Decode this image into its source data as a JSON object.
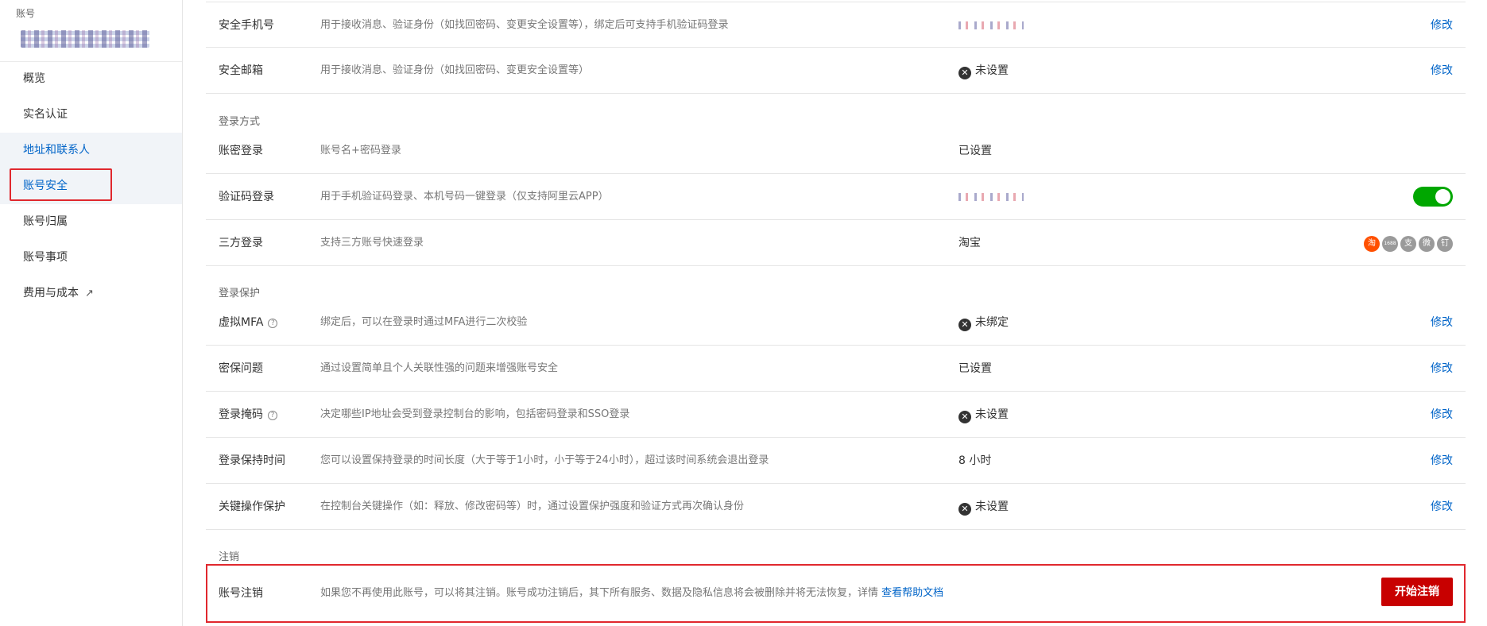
{
  "sidebar": {
    "account_label": "账号",
    "nav": [
      {
        "label": "概览"
      },
      {
        "label": "实名认证"
      },
      {
        "label": "地址和联系人"
      },
      {
        "label": "账号安全"
      },
      {
        "label": "账号归属"
      },
      {
        "label": "账号事项"
      },
      {
        "label": "费用与成本"
      }
    ],
    "active_item": "地址和联系人",
    "external_icon": "external-link-icon"
  },
  "rows": {
    "phone": {
      "name": "安全手机号",
      "desc": "用于接收消息、验证身份（如找回密码、变更安全设置等），绑定后可支持手机验证码登录",
      "action": "修改"
    },
    "email": {
      "name": "安全邮箱",
      "desc": "用于接收消息、验证身份（如找回密码、变更安全设置等）",
      "status": "未设置",
      "action": "修改"
    },
    "password_login": {
      "name": "账密登录",
      "desc": "账号名+密码登录",
      "status": "已设置"
    },
    "sms_login": {
      "name": "验证码登录",
      "desc": "用于手机验证码登录、本机号码一键登录（仅支持阿里云APP）",
      "toggle_on": true
    },
    "third_party": {
      "name": "三方登录",
      "desc": "支持三方账号快速登录",
      "status": "淘宝",
      "icons": [
        "淘",
        "1688",
        "支",
        "微",
        "钉"
      ]
    },
    "mfa": {
      "name": "虚拟MFA",
      "desc": "绑定后，可以在登录时通过MFA进行二次校验",
      "status": "未绑定",
      "action": "修改"
    },
    "security_question": {
      "name": "密保问题",
      "desc": "通过设置简单且个人关联性强的问题来增强账号安全",
      "status": "已设置",
      "action": "修改"
    },
    "login_mask": {
      "name": "登录掩码",
      "desc": "决定哪些IP地址会受到登录控制台的影响，包括密码登录和SSO登录",
      "status": "未设置",
      "action": "修改"
    },
    "session_time": {
      "name": "登录保持时间",
      "desc": "您可以设置保持登录的时间长度（大于等于1小时，小于等于24小时），超过该时间系统会退出登录",
      "status": "8 小时",
      "action": "修改"
    },
    "critical_op": {
      "name": "关键操作保护",
      "desc": "在控制台关键操作（如：释放、修改密码等）时，通过设置保护强度和验证方式再次确认身份",
      "status": "未设置",
      "action": "修改"
    }
  },
  "sections": {
    "login_methods": "登录方式",
    "login_protection": "登录保护",
    "deregister": "注销"
  },
  "deregister": {
    "name": "账号注销",
    "desc": "如果您不再使用此账号，可以将其注销。账号成功注销后，其下所有服务、数据及隐私信息将会被删除并将无法恢复，详情",
    "link": "查看帮助文档",
    "button": "开始注销"
  },
  "colors": {
    "link": "#0064c8",
    "danger": "#c80000",
    "toggle_on": "#00a700",
    "highlight": "#e0282e"
  }
}
